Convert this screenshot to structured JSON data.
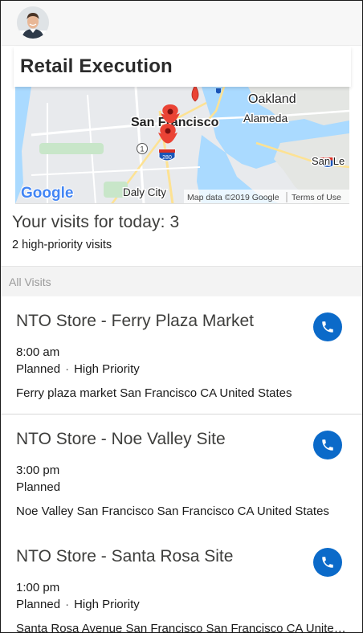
{
  "app": {
    "title": "Retail Execution"
  },
  "map": {
    "labels": {
      "oakland": "Oakland",
      "alameda": "Alameda",
      "san_francisco": "San Francisco",
      "daly_city": "Daly City",
      "san_leandro": "San Le",
      "highway_1": "1",
      "highway_280": "280"
    },
    "google_logo": "Google",
    "attribution": "Map data ©2019 Google",
    "terms": "Terms of Use",
    "colors": {
      "water": "#aadaff",
      "land": "#e8eaed",
      "pin": "#ea4335"
    }
  },
  "summary": {
    "visits_today": "Your visits for today: 3",
    "high_priority": "2 high-priority visits"
  },
  "section": {
    "label": "All Visits"
  },
  "visits": [
    {
      "name": "NTO Store - Ferry Plaza Market",
      "time": "8:00 am",
      "status": "Planned",
      "priority": "High Priority",
      "separator": "·",
      "address": "Ferry plaza market San Francisco CA United States"
    },
    {
      "name": "NTO Store - Noe Valley Site",
      "time": "3:00 pm",
      "status": "Planned",
      "priority": "",
      "separator": "",
      "address": "Noe Valley San Francisco San Francisco CA United States"
    },
    {
      "name": "NTO Store - Santa Rosa Site",
      "time": "1:00 pm",
      "status": "Planned",
      "priority": "High Priority",
      "separator": "·",
      "address": "Santa Rosa Avenue San Francisco San Francisco CA United States"
    }
  ],
  "icons": {
    "avatar": "user-avatar",
    "call": "phone-icon",
    "pin": "map-pin-icon"
  },
  "colors": {
    "accent": "#0b6ac9",
    "text": "#3e3e3c",
    "section_bg": "#f3f3f3"
  }
}
